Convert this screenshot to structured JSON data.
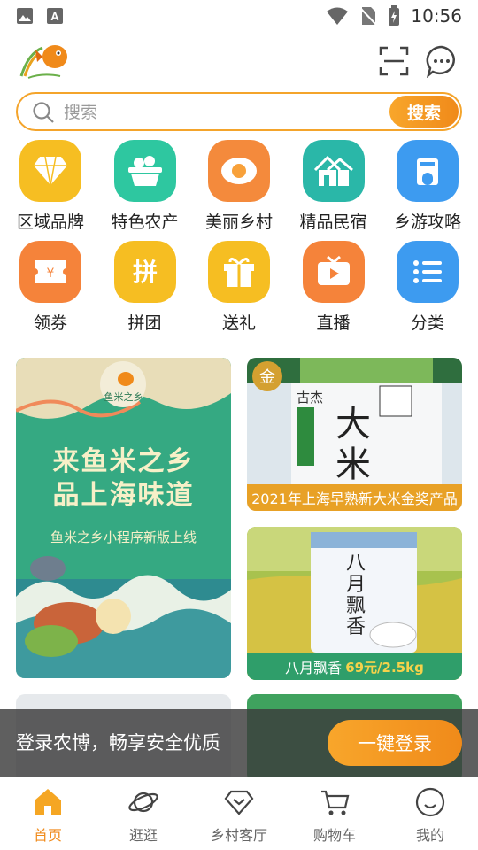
{
  "status_bar": {
    "time": "10:56"
  },
  "search": {
    "placeholder": "搜索",
    "button_label": "搜索"
  },
  "categories": [
    {
      "label": "区域品牌",
      "icon": "diamond-icon",
      "color": "#F6BE22"
    },
    {
      "label": "特色农产",
      "icon": "basket-icon",
      "color": "#2EC7A0"
    },
    {
      "label": "美丽乡村",
      "icon": "egg-icon",
      "color": "#F48A3C"
    },
    {
      "label": "精品民宿",
      "icon": "house-icon",
      "color": "#2AB7A8"
    },
    {
      "label": "乡游攻略",
      "icon": "building-icon",
      "color": "#3D9BF0"
    },
    {
      "label": "领券",
      "icon": "coupon-icon",
      "color": "#F5833A"
    },
    {
      "label": "拼团",
      "icon": "group-buy-icon",
      "color": "#F6BE22"
    },
    {
      "label": "送礼",
      "icon": "gift-icon",
      "color": "#F6BE22"
    },
    {
      "label": "直播",
      "icon": "tv-icon",
      "color": "#F5833A"
    },
    {
      "label": "分类",
      "icon": "list-icon",
      "color": "#3D9BF0"
    }
  ],
  "promo": {
    "banner": {
      "brand": "鱼米之乡",
      "line1": "来鱼米之乡",
      "line2": "品上海味道",
      "subline": "鱼米之乡小程序新版上线"
    },
    "rice_card": {
      "caption": "2021年上海早熟新大米金奖产品",
      "badge": "金",
      "brand": "古杰",
      "product": "大米"
    },
    "bayue_card": {
      "caption_name": "八月飘香",
      "caption_price": "69元/2.5kg",
      "bag_text": "八月飘香"
    }
  },
  "login_prompt": {
    "text": "登录农博，畅享安全优质",
    "button_label": "一键登录"
  },
  "tabs": [
    {
      "label": "首页",
      "active": true
    },
    {
      "label": "逛逛",
      "active": false
    },
    {
      "label": "乡村客厅",
      "active": false
    },
    {
      "label": "购物车",
      "active": false
    },
    {
      "label": "我的",
      "active": false
    }
  ],
  "colors": {
    "accent": "#F08A1A",
    "banner_green": "#2FA27B"
  }
}
